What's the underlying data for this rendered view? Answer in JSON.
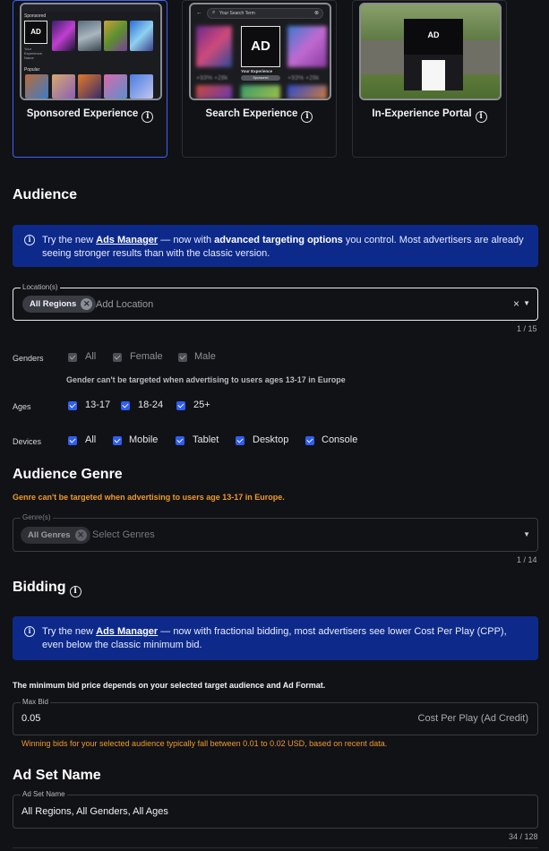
{
  "ad_formats": [
    {
      "label": "Sponsored Experience",
      "selected": true
    },
    {
      "label": "Search Experience",
      "selected": false
    },
    {
      "label": "In-Experience Portal",
      "selected": false
    }
  ],
  "thumbs": {
    "sponsored": {
      "section1": "Sponsored",
      "section2": "Popular",
      "ad": "AD",
      "caption": "Your Experience Name"
    },
    "search": {
      "search_placeholder": "Your Search Term",
      "ad": "AD",
      "caption": "Your Experience",
      "badge": "Sponsored",
      "stat1": "+93% +28k",
      "stat2": "+93% +28k"
    },
    "portal": {
      "ad": "AD"
    }
  },
  "audience": {
    "title": "Audience",
    "banner": {
      "prefix": "Try the new ",
      "link": "Ads Manager",
      "middle": " — now with ",
      "bold": "advanced targeting options",
      "suffix": " you control. Most advertisers are already seeing stronger results than with the classic version."
    },
    "location": {
      "legend": "Location(s)",
      "chip": "All Regions",
      "placeholder": "Add Location",
      "counter": "1 / 15"
    },
    "genders": {
      "label": "Genders",
      "options": [
        "All",
        "Female",
        "Male"
      ],
      "note": "Gender can't be targeted when advertising to users ages 13-17 in Europe"
    },
    "ages": {
      "label": "Ages",
      "options": [
        "13-17",
        "18-24",
        "25+"
      ]
    },
    "devices": {
      "label": "Devices",
      "options": [
        "All",
        "Mobile",
        "Tablet",
        "Desktop",
        "Console"
      ]
    }
  },
  "genre": {
    "title": "Audience Genre",
    "warning": "Genre can't be targeted when advertising to users age 13-17 in Europe.",
    "legend": "Genre(s)",
    "chip": "All Genres",
    "placeholder": "Select Genres",
    "counter": "1 / 14"
  },
  "bidding": {
    "title": "Bidding",
    "banner": {
      "prefix": "Try the new ",
      "link": "Ads Manager",
      "suffix": " — now with fractional bidding, most advertisers see lower Cost Per Play (CPP), even below the classic minimum bid."
    },
    "min_bid_note": "The minimum bid price depends on your selected target audience and Ad Format.",
    "max_bid_legend": "Max Bid",
    "max_bid_value": "0.05",
    "unit": "Cost Per Play (Ad Credit)",
    "hint": "Winning bids for your selected audience typically fall between 0.01 to 0.02 USD, based on recent data."
  },
  "ad_set": {
    "title": "Ad Set Name",
    "legend": "Ad Set Name",
    "value": "All Regions, All Genders, All Ages",
    "counter": "34 / 128"
  },
  "colors": {
    "accent": "#2f5ef0",
    "banner": "#0d2a8a",
    "warning": "#ef9a2a",
    "selected_border": "#3b63f6"
  }
}
